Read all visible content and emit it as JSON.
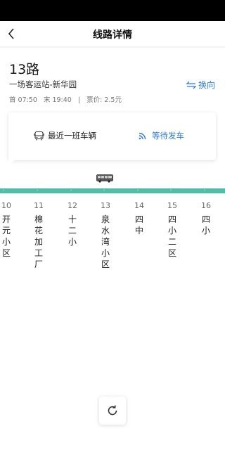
{
  "nav": {
    "title": "线路详情"
  },
  "route": {
    "name": "13路",
    "span": "一场客运站-新华园",
    "first_bus": "首 07:50",
    "last_bus": "末 19:40",
    "separator": "|",
    "fare": "票价:  2.5元",
    "switch_label": "换向"
  },
  "status": {
    "latest_bus_label": "最近一班车辆",
    "waiting_label": "等待发车"
  },
  "colors": {
    "accent": "#2f7bd6",
    "route_line": "#4cbfa6"
  },
  "stops": [
    {
      "num": "10",
      "name": "开元小区"
    },
    {
      "num": "11",
      "name": "棉花加工厂"
    },
    {
      "num": "12",
      "name": "十二小"
    },
    {
      "num": "13",
      "name": "泉水湾小区"
    },
    {
      "num": "14",
      "name": "四中"
    },
    {
      "num": "15",
      "name": "四小二区"
    },
    {
      "num": "16",
      "name": "四小"
    }
  ]
}
